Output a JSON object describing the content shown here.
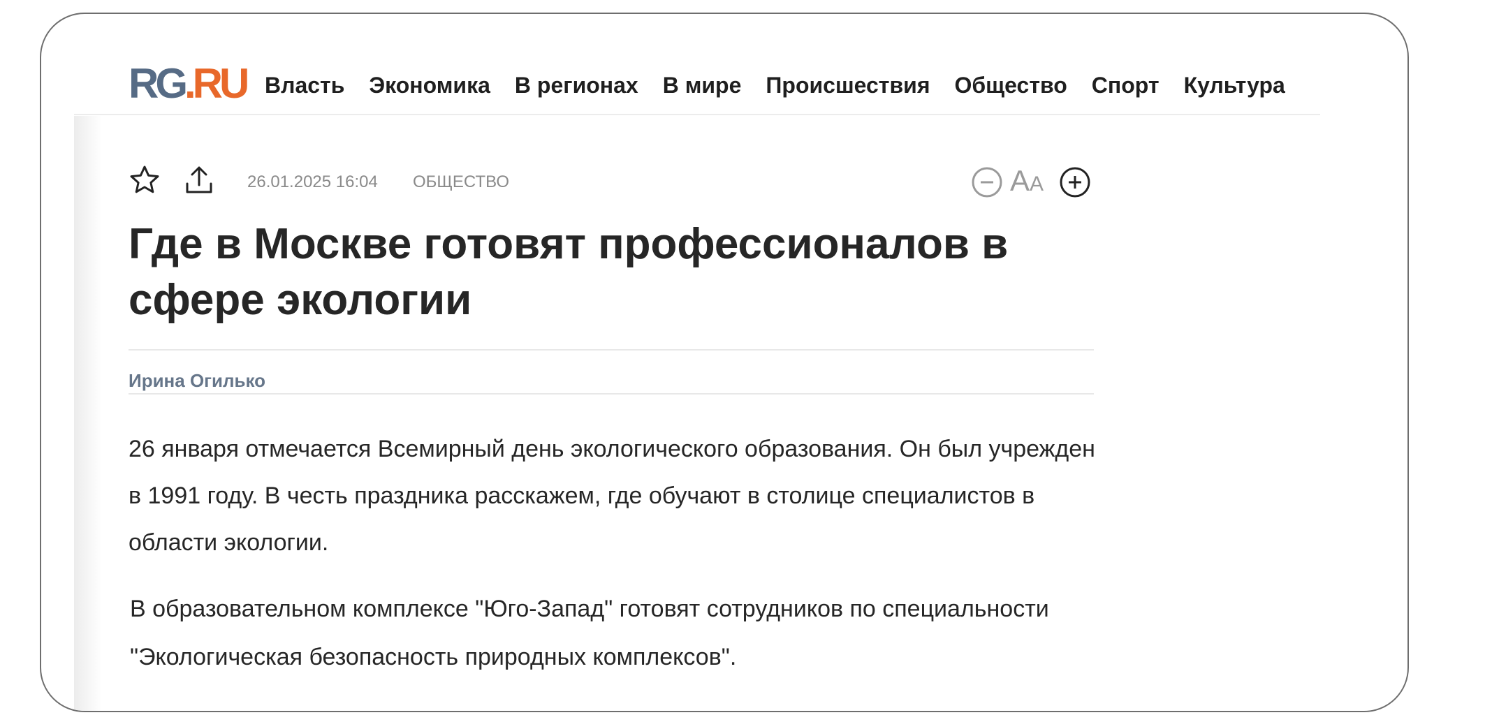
{
  "logo": {
    "rg": "RG",
    "ru": ".RU"
  },
  "nav": [
    "Власть",
    "Экономика",
    "В регионах",
    "В мире",
    "Происшествия",
    "Общество",
    "Спорт",
    "Культура"
  ],
  "meta": {
    "date": "26.01.2025 16:04",
    "rubric": "ОБЩЕСТВО",
    "font_label_big": "А",
    "font_label_small": "А"
  },
  "article": {
    "title": "Где в Москве готовят профессионалов в сфере экологии",
    "author": "Ирина Огилько",
    "lead": "26 января отмечается Всемирный день экологического образования. Он был учрежден в 1991 году. В честь праздника расскажем, где обучают в столице специалистов в области экологии.",
    "paragraph": "В образовательном комплексе \"Юго-Запад\" готовят сотрудников по специальности \"Экологическая безопасность природных комплексов\"."
  },
  "colors": {
    "brand_gray": "#566b85",
    "brand_orange": "#e8682a",
    "author": "#66768a"
  },
  "icons": [
    "star-icon",
    "share-icon",
    "font-decrease-icon",
    "font-increase-icon"
  ]
}
